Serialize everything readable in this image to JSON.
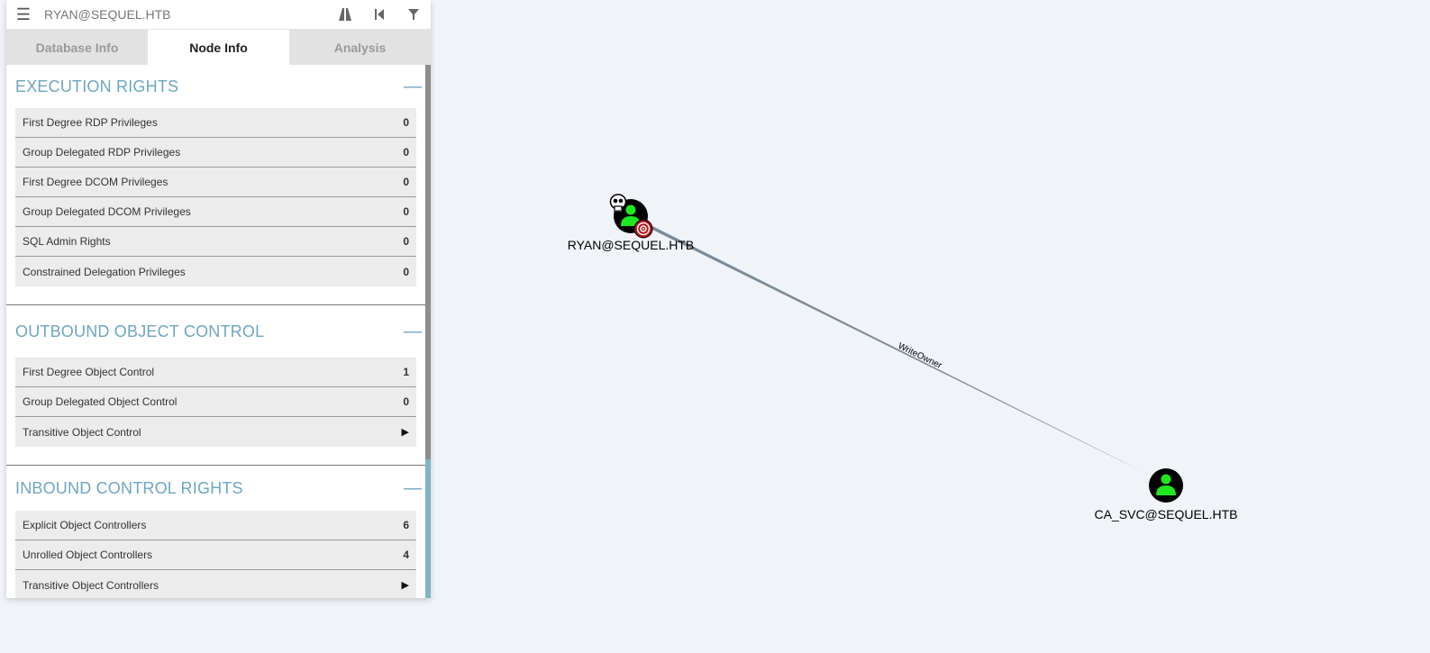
{
  "search": {
    "menu_icon": "hamburger-icon",
    "value": "RYAN@SEQUEL.HTB",
    "icons": [
      "pathfinding-icon",
      "back-icon",
      "filter-icon"
    ]
  },
  "tabs": [
    {
      "label": "Database Info",
      "active": false
    },
    {
      "label": "Node Info",
      "active": true
    },
    {
      "label": "Analysis",
      "active": false
    }
  ],
  "sections": {
    "execution": {
      "title": "EXECUTION RIGHTS",
      "rows": [
        {
          "label": "First Degree RDP Privileges",
          "value": "0"
        },
        {
          "label": "Group Delegated RDP Privileges",
          "value": "0"
        },
        {
          "label": "First Degree DCOM Privileges",
          "value": "0"
        },
        {
          "label": "Group Delegated DCOM Privileges",
          "value": "0"
        },
        {
          "label": "SQL Admin Rights",
          "value": "0"
        },
        {
          "label": "Constrained Delegation Privileges",
          "value": "0"
        }
      ]
    },
    "outbound": {
      "title": "OUTBOUND OBJECT CONTROL",
      "rows": [
        {
          "label": "First Degree Object Control",
          "value": "1"
        },
        {
          "label": "Group Delegated Object Control",
          "value": "0"
        },
        {
          "label": "Transitive Object Control",
          "value": "▶"
        }
      ]
    },
    "inbound": {
      "title": "INBOUND CONTROL RIGHTS",
      "rows": [
        {
          "label": "Explicit Object Controllers",
          "value": "6"
        },
        {
          "label": "Unrolled Object Controllers",
          "value": "4"
        },
        {
          "label": "Transitive Object Controllers",
          "value": "▶"
        }
      ]
    }
  },
  "graph": {
    "nodes": [
      {
        "label": "RYAN@SEQUEL.HTB",
        "icons": [
          "user-icon",
          "owned-skull-icon",
          "target-icon"
        ]
      },
      {
        "label": "CA_SVC@SEQUEL.HTB",
        "icons": [
          "user-icon"
        ]
      }
    ],
    "edge": {
      "label": "WriteOwner"
    }
  },
  "colors": {
    "accent": "#6ea6c1",
    "node_fill": "#000000",
    "user_green": "#1ee81e",
    "edge": "#7a8a98",
    "background": "#f0f3f8"
  }
}
